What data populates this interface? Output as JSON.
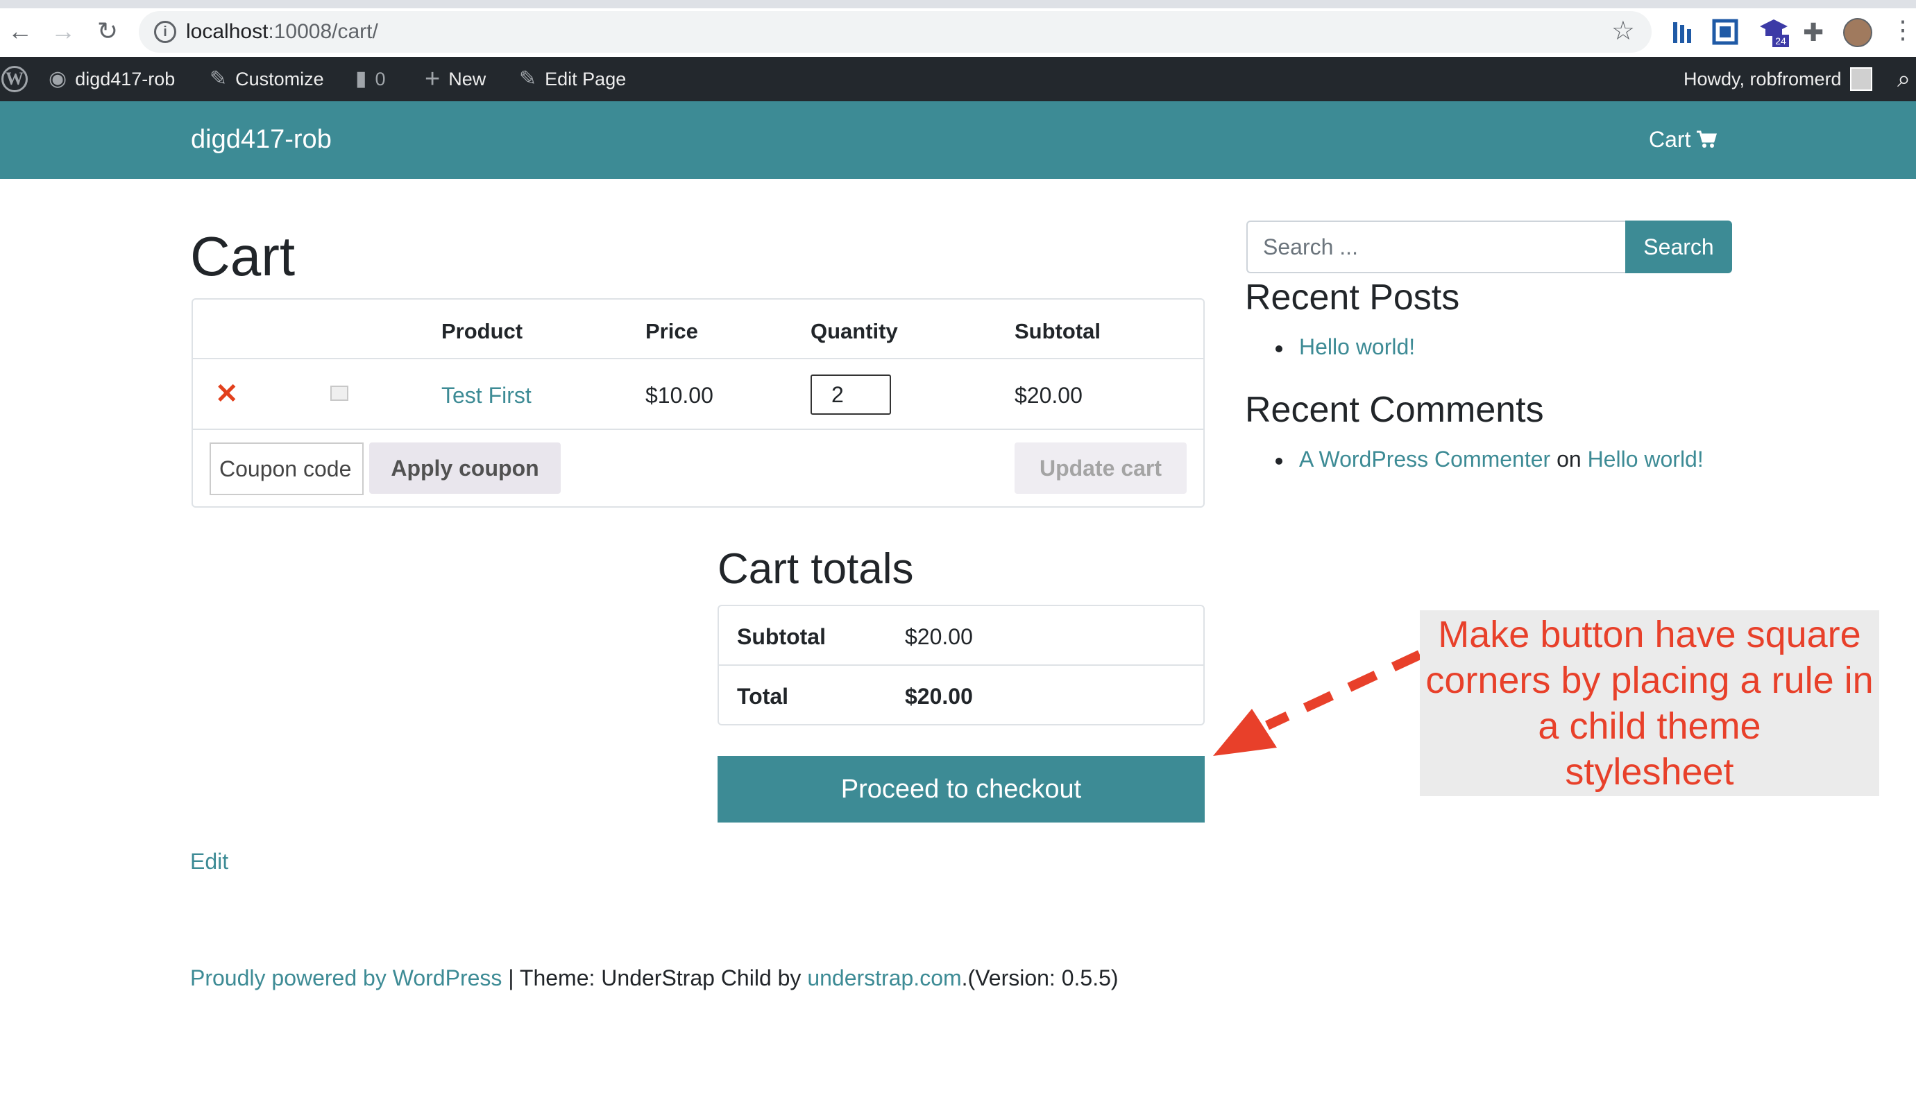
{
  "browser": {
    "url_host": "localhost",
    "url_path": ":10008/cart/",
    "extension_badge": "24"
  },
  "adminbar": {
    "site": "digd417-rob",
    "customize": "Customize",
    "comments_count": "0",
    "new": "New",
    "edit_page": "Edit Page",
    "howdy": "Howdy, robfromerd"
  },
  "header": {
    "site_title": "digd417-rob",
    "cart_label": "Cart"
  },
  "main": {
    "title": "Cart",
    "table": {
      "headers": [
        "Product",
        "Price",
        "Quantity",
        "Subtotal"
      ],
      "row": {
        "product": "Test First",
        "price": "$10.00",
        "quantity": "2",
        "subtotal": "$20.00"
      },
      "coupon_placeholder": "Coupon code",
      "apply_coupon": "Apply coupon",
      "update_cart": "Update cart"
    },
    "totals": {
      "title": "Cart totals",
      "subtotal_label": "Subtotal",
      "subtotal_value": "$20.00",
      "total_label": "Total",
      "total_value": "$20.00"
    },
    "checkout": "Proceed to checkout",
    "edit": "Edit"
  },
  "footer": {
    "powered": "Proudly powered by WordPress",
    "separator": " | Theme: UnderStrap Child by ",
    "understrap": "understrap.com",
    "version": ".(Version: 0.5.5)"
  },
  "sidebar": {
    "search_placeholder": "Search ...",
    "search_button": "Search",
    "recent_posts_title": "Recent Posts",
    "recent_posts": [
      "Hello world!"
    ],
    "recent_comments_title": "Recent Comments",
    "comment_author": "A WordPress Commenter",
    "comment_on": "on",
    "comment_post": "Hello world!"
  },
  "annotation": {
    "text_lines": [
      "Make button have square",
      "corners by placing a rule in",
      "a child theme",
      "stylesheet"
    ]
  },
  "colors": {
    "accent": "#3d8b95",
    "adminbar": "#23282d",
    "remove": "#e2401c",
    "annotation": "#e8402a"
  }
}
